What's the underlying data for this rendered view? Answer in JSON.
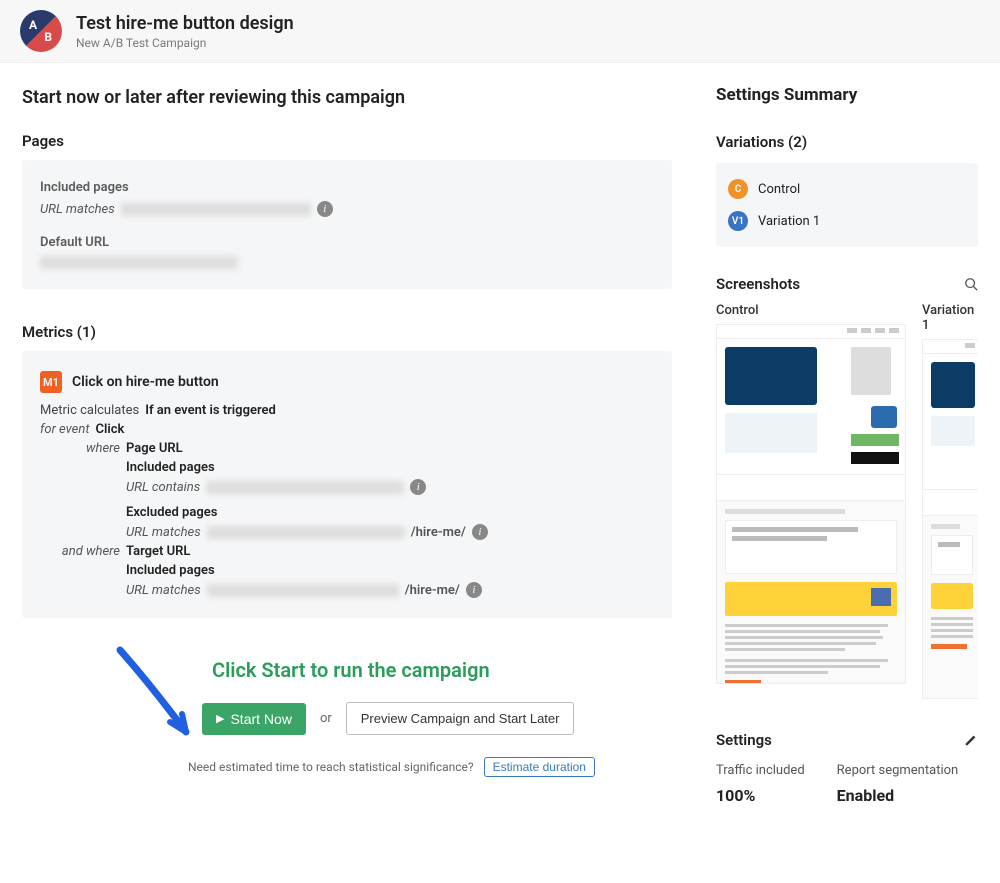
{
  "header": {
    "badge_a": "A",
    "badge_b": "B",
    "title": "Test hire-me button design",
    "subtitle": "New A/B Test Campaign"
  },
  "main": {
    "heading": "Start now or later after reviewing this campaign",
    "pages": {
      "label": "Pages",
      "included_label": "Included pages",
      "url_matches_label": "URL matches",
      "default_url_label": "Default URL"
    },
    "metrics": {
      "label": "Metrics (1)",
      "badge": "M1",
      "title": "Click on hire-me button",
      "calculates_label": "Metric calculates",
      "calculates_value": "If an event is triggered",
      "for_event_label": "for event",
      "for_event_value": "Click",
      "where_label": "where",
      "page_url_label": "Page URL",
      "included_pages_label": "Included pages",
      "url_contains_label": "URL contains",
      "excluded_pages_label": "Excluded pages",
      "url_matches_label": "URL matches",
      "url_suffix": "/hire-me/",
      "and_where_label": "and where",
      "target_url_label": "Target URL",
      "target_url_suffix": "/hire-me/"
    },
    "callout": {
      "instruction": "Click Start to run the campaign",
      "start_button": "Start Now",
      "or": "or",
      "preview_button": "Preview Campaign and Start Later",
      "estimate_question": "Need estimated time to reach statistical significance?",
      "estimate_button": "Estimate duration"
    }
  },
  "right": {
    "summary_heading": "Settings Summary",
    "variations_heading": "Variations (2)",
    "variations": [
      {
        "badge": "C",
        "badge_class": "vc",
        "label": "Control"
      },
      {
        "badge": "V1",
        "badge_class": "v1",
        "label": "Variation 1"
      }
    ],
    "screenshots_heading": "Screenshots",
    "screenshot_labels": [
      "Control",
      "Variation 1"
    ],
    "settings_heading": "Settings",
    "traffic_label": "Traffic included",
    "traffic_value": "100%",
    "report_label": "Report segmentation",
    "report_value": "Enabled"
  }
}
